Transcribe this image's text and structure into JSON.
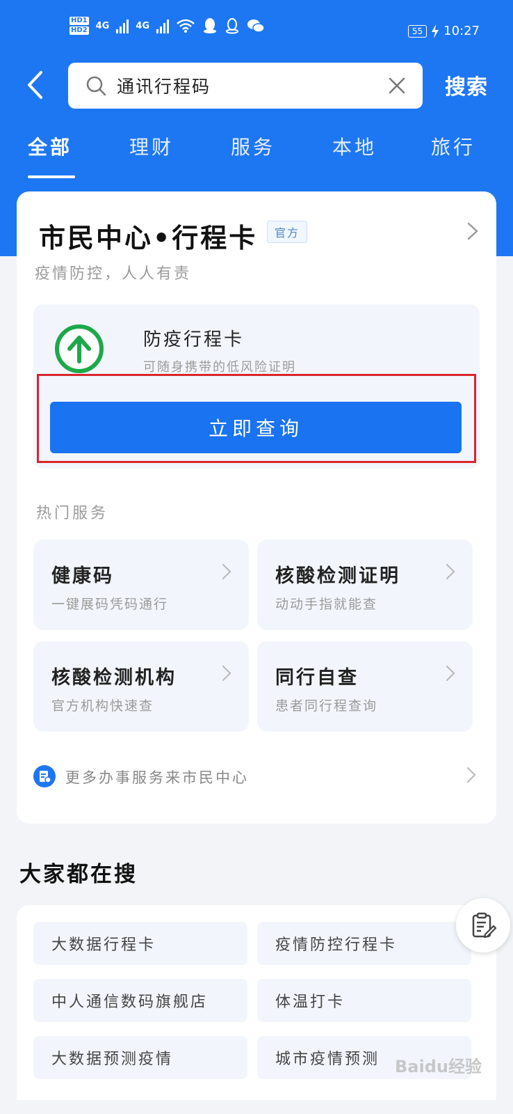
{
  "status_bar": {
    "hd1": "HD1",
    "hd2": "HD2",
    "net1": "4G",
    "net2": "4G",
    "battery": "55",
    "time": "10:27"
  },
  "search": {
    "query": "通讯行程码",
    "button_label": "搜索"
  },
  "tabs": [
    {
      "label": "全部",
      "active": true
    },
    {
      "label": "理财",
      "active": false
    },
    {
      "label": "服务",
      "active": false
    },
    {
      "label": "本地",
      "active": false
    },
    {
      "label": "旅行",
      "active": false
    }
  ],
  "main_card": {
    "title": "市民中心•行程卡",
    "badge": "官方",
    "subtitle": "疫情防控，人人有责",
    "panel": {
      "title": "防疫行程卡",
      "subtitle": "可随身携带的低风险证明",
      "button_label": "立即查询"
    },
    "hot_label": "热门服务",
    "services": [
      {
        "title": "健康码",
        "subtitle": "一键展码凭码通行"
      },
      {
        "title": "核酸检测证明",
        "subtitle": "动动手指就能查"
      },
      {
        "title": "核酸检测机构",
        "subtitle": "官方机构快速查"
      },
      {
        "title": "同行自查",
        "subtitle": "患者同行程查询"
      }
    ],
    "more_text": "更多办事服务来市民中心"
  },
  "trending": {
    "title": "大家都在搜",
    "items": [
      "大数据行程卡",
      "疫情防控行程卡",
      "中人通信数码旗舰店",
      "体温打卡",
      "大数据预测疫情",
      "城市疫情预测"
    ]
  },
  "watermark": "Baidu经验",
  "colors": {
    "brand_blue": "#1e77f2",
    "button_blue": "#1a73f0",
    "highlight_red": "#d9262b",
    "logo_green": "#1ea84a"
  },
  "icons": [
    "back-arrow-icon",
    "search-icon",
    "clear-icon",
    "chevron-right-icon",
    "green-arrow-up-icon",
    "document-icon",
    "clipboard-edit-icon"
  ]
}
